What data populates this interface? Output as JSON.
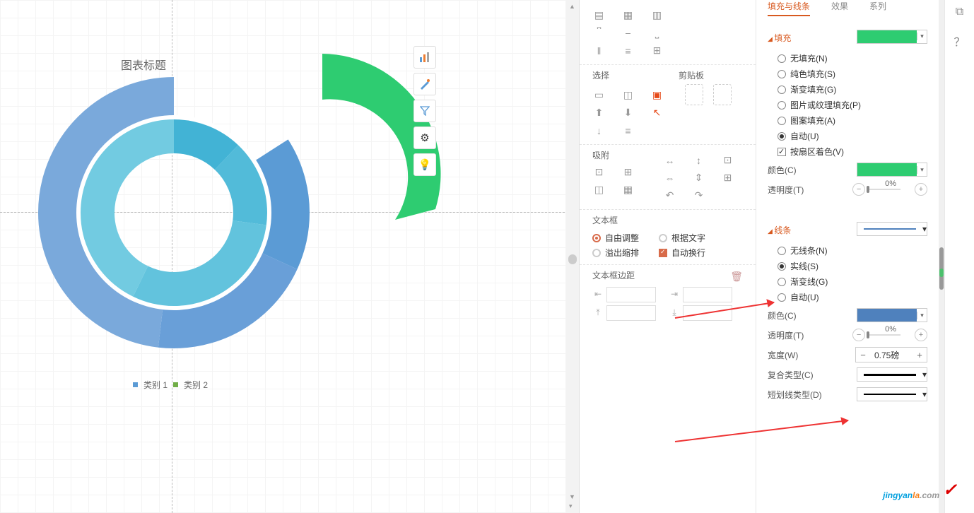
{
  "chart_data": {
    "type": "pie",
    "title": "图表标题",
    "series": [
      {
        "name": "类别 1",
        "color": "#5b9bd5",
        "values": [
          16,
          18,
          22,
          44
        ]
      },
      {
        "name": "类别 2",
        "color": "#42b3d5",
        "values": [
          12,
          15,
          30,
          43
        ]
      }
    ],
    "detached_slice": {
      "series_name": "类别 1",
      "index": 0,
      "value": 16,
      "color": "#2ecc71",
      "explode": true
    }
  },
  "chart_title": "图表标题",
  "legend": {
    "cat1": "类别 1",
    "cat2": "类别 2",
    "c1": "#5b9bd5",
    "c2": "#70ad47"
  },
  "mid": {
    "select_h": "选择",
    "clip_h": "剪贴板",
    "snap_h": "吸附",
    "text_h": "文本框",
    "t_auto": "自由调整",
    "t_fit": "根据文字",
    "t_over": "溢出缩排",
    "t_wrap": "自动换行",
    "margin_h": "文本框边距"
  },
  "tabs": {
    "fill": "填充与线条",
    "fx": "效果",
    "series": "系列"
  },
  "fill": {
    "sect": "填充",
    "none": "无填充(N)",
    "solid": "纯色填充(S)",
    "grad": "渐变填充(G)",
    "pic": "图片或纹理填充(P)",
    "pat": "图案填充(A)",
    "auto": "自动(U)",
    "byslice": "按扇区着色(V)",
    "color_l": "颜色(C)",
    "trans_l": "透明度(T)",
    "trans_v": "0%",
    "swatch": "#2ecc71"
  },
  "line": {
    "sect": "线条",
    "none": "无线条(N)",
    "solid": "实线(S)",
    "grad": "渐变线(G)",
    "auto": "自动(U)",
    "color_l": "颜色(C)",
    "trans_l": "透明度(T)",
    "trans_v": "0%",
    "width_l": "宽度(W)",
    "width_v": "0.75磅",
    "compound_l": "复合类型(C)",
    "dash_l": "短划线类型(D)",
    "swatch": "#4f81bd"
  },
  "watermark": {
    "a": "jingyan",
    "b": "la",
    "c": ".com"
  }
}
